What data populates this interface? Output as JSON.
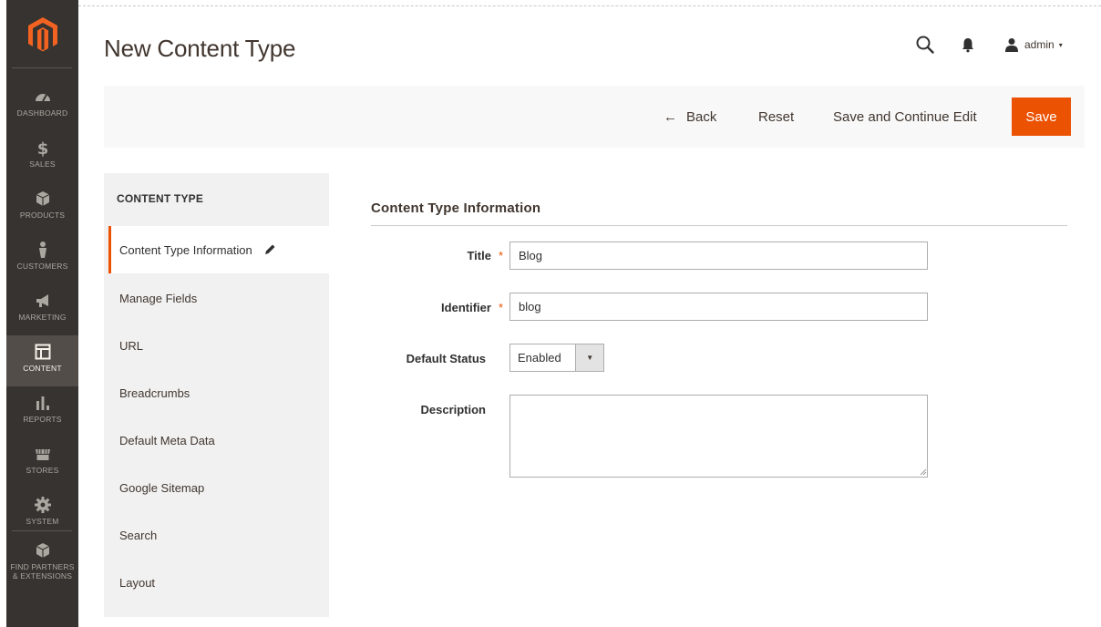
{
  "header": {
    "page_title": "New Content Type",
    "user_name": "admin",
    "user_caret": "▾"
  },
  "sidebar": {
    "items": [
      {
        "label": "DASHBOARD",
        "icon": "dashboard-icon"
      },
      {
        "label": "SALES",
        "icon": "dollar-icon"
      },
      {
        "label": "PRODUCTS",
        "icon": "cube-icon"
      },
      {
        "label": "CUSTOMERS",
        "icon": "person-icon"
      },
      {
        "label": "MARKETING",
        "icon": "megaphone-icon"
      },
      {
        "label": "CONTENT",
        "icon": "layout-icon",
        "active": true
      },
      {
        "label": "REPORTS",
        "icon": "bar-chart-icon"
      },
      {
        "label": "STORES",
        "icon": "store-icon"
      },
      {
        "label": "SYSTEM",
        "icon": "gear-icon"
      },
      {
        "label_line1": "FIND PARTNERS",
        "label_line2": "& EXTENSIONS",
        "icon": "cube-icon"
      }
    ]
  },
  "actions": {
    "back_arrow": "←",
    "back": "Back",
    "reset": "Reset",
    "save_continue": "Save and Continue Edit",
    "save": "Save"
  },
  "tabs": {
    "header": "CONTENT TYPE",
    "active": "Content Type Information",
    "items": [
      "Manage Fields",
      "URL",
      "Breadcrumbs",
      "Default Meta Data",
      "Google Sitemap",
      "Search",
      "Layout"
    ]
  },
  "form": {
    "section_title": "Content Type Information",
    "title_label": "Title",
    "title_value": "Blog",
    "identifier_label": "Identifier",
    "identifier_value": "blog",
    "required_mark": "*",
    "status_label": "Default Status",
    "status_value": "Enabled",
    "status_arrow": "▼",
    "description_label": "Description",
    "description_value": ""
  },
  "colors": {
    "accent": "#eb5202",
    "sidebar_bg": "#373330",
    "sidebar_active": "#524d49"
  }
}
